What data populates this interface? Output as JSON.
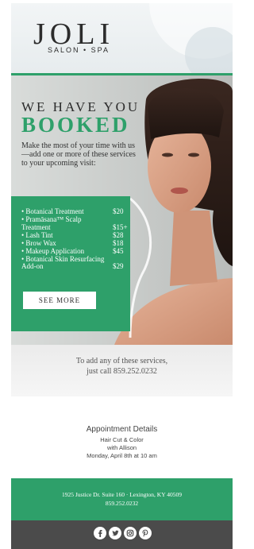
{
  "brand": {
    "name": "JOLI",
    "subtitle": "SALON • SPA"
  },
  "hero": {
    "headline_1": "WE HAVE YOU",
    "headline_2": "BOOKED",
    "intro": "Make the most of your time with us—add one or more of these services to your upcoming visit:",
    "services": [
      {
        "name": "• Botanical Treatment",
        "price": "$20"
      },
      {
        "name": "• Pramāsana™ Scalp Treatment",
        "price": "$15+"
      },
      {
        "name": "• Lash Tint",
        "price": "$28"
      },
      {
        "name": "• Brow Wax",
        "price": "$18"
      },
      {
        "name": "• Makeup Application",
        "price": "$45"
      },
      {
        "name": "• Botanical Skin Resurfacing Add-on",
        "price": "$29"
      }
    ],
    "cta_label": "SEE MORE"
  },
  "call": {
    "line_1": "To add any of these services,",
    "line_2": "just call 859.252.0232"
  },
  "appointment": {
    "title": "Appointment Details",
    "service": "Hair Cut & Color",
    "stylist": "with Allison",
    "datetime": "Monday, April 8th at 10 am"
  },
  "address": {
    "line_1": "1925 Justice Dr. Suite 160 · Lexington, KY 40509",
    "line_2": "859.252.0232"
  },
  "social": [
    "facebook-icon",
    "twitter-icon",
    "instagram-icon",
    "pinterest-icon"
  ],
  "colors": {
    "accent": "#2ea06a",
    "footer": "#4b4b4b"
  }
}
